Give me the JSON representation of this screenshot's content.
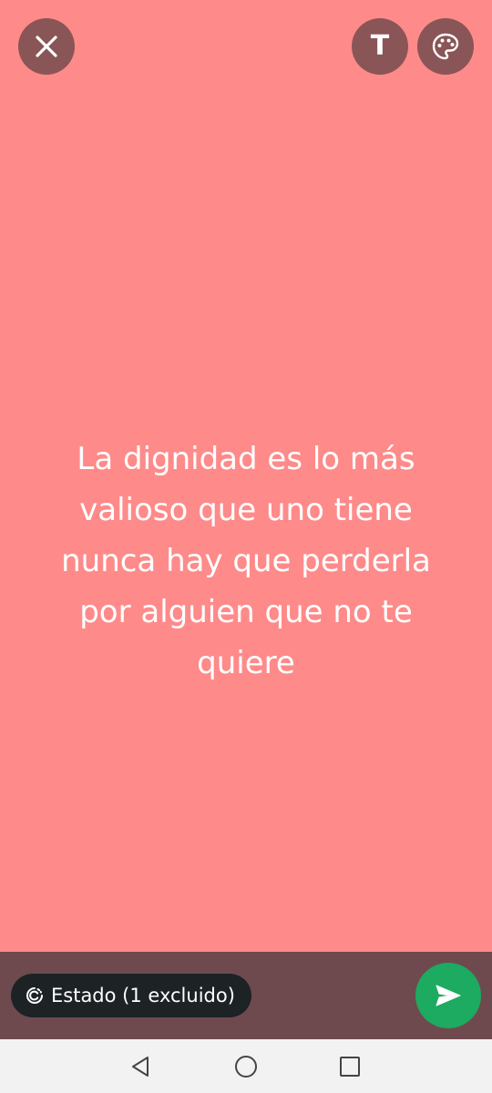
{
  "top_bar": {
    "close_icon": "close-icon",
    "text_button_label": "T",
    "palette_icon": "palette-icon"
  },
  "status": {
    "text": "La dignidad es lo más\nvalioso que uno tiene\nnunca hay que perderla\npor alguien que no te\nquiere",
    "background_color": "#ff8a8a",
    "text_color": "#ffffff"
  },
  "bottom_bar": {
    "audience_icon": "status-privacy-icon",
    "audience_label": "Estado (1 excluido)",
    "send_icon": "send-icon",
    "send_color": "#1daa61"
  },
  "nav_bar": {
    "back_icon": "back-triangle-icon",
    "home_icon": "home-circle-icon",
    "recents_icon": "recents-square-icon"
  }
}
